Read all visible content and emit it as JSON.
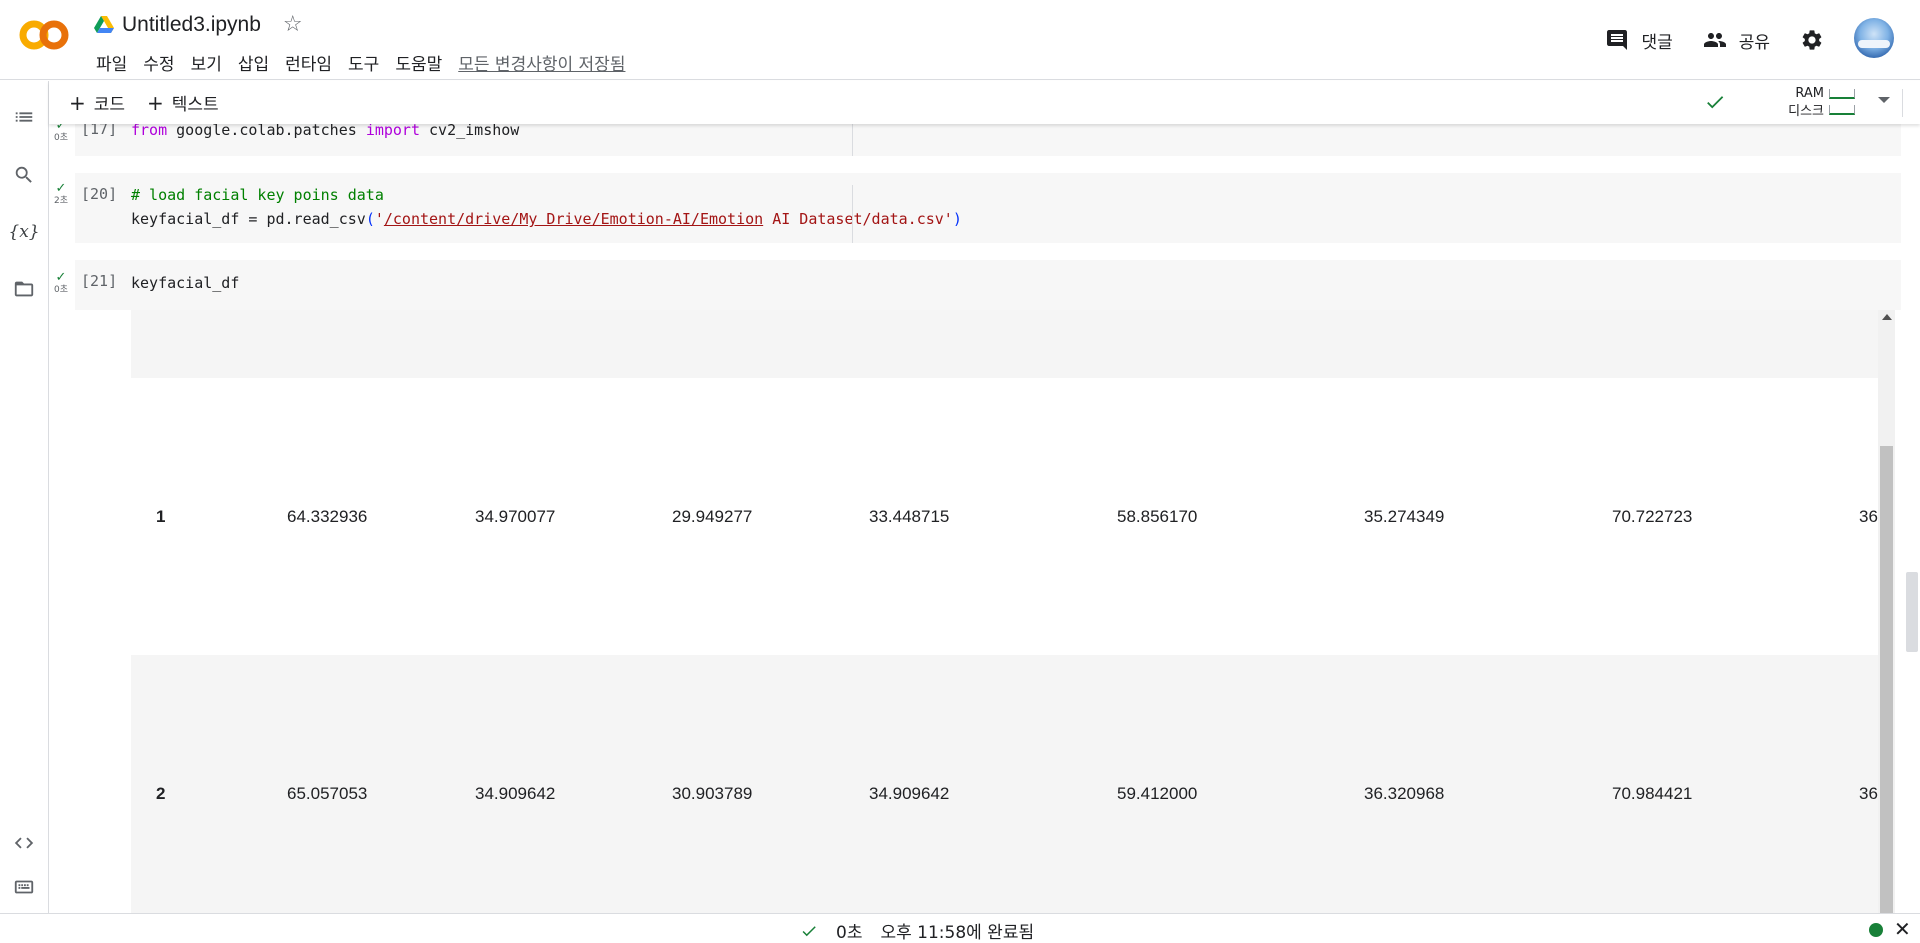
{
  "header": {
    "title": "Untitled3.ipynb",
    "menu": [
      "파일",
      "수정",
      "보기",
      "삽입",
      "런타임",
      "도구",
      "도움말"
    ],
    "saved_status": "모든 변경사항이 저장됨",
    "comment_label": "댓글",
    "share_label": "공유",
    "icons": {
      "logo": "colab-logo",
      "drive": "drive-icon",
      "star": "star-icon",
      "comment": "comment-icon",
      "share": "people-icon",
      "settings": "gear-icon"
    }
  },
  "toolbar": {
    "add_code": "코드",
    "add_text": "텍스트",
    "resources": {
      "ram": "RAM",
      "disk": "디스크"
    }
  },
  "cells": [
    {
      "exec_count": "[17]",
      "run_time": "0초",
      "code": {
        "kw1": "from",
        "mod": " google.colab.patches ",
        "kw2": "import",
        "name": " cv2_imshow"
      }
    },
    {
      "exec_count": "[20]",
      "run_time": "2초",
      "code": {
        "comment": "# load facial key poins data",
        "prefix": "keyfacial_df = pd.read_csv",
        "open": "(",
        "q1": "'",
        "path_link": "/content/drive/My Drive/Emotion-AI/Emotion",
        "path_rest": " AI Dataset/data.csv",
        "q2": "'",
        "close": ")"
      }
    },
    {
      "exec_count": "[21]",
      "run_time": "0초",
      "code": {
        "line": "keyfacial_df"
      }
    }
  ],
  "output_table": {
    "rows": [
      {
        "index": "1",
        "values": [
          "64.332936",
          "34.970077",
          "29.949277",
          "33.448715",
          "58.856170",
          "35.274349",
          "70.722723",
          "36"
        ]
      },
      {
        "index": "2",
        "values": [
          "65.057053",
          "34.909642",
          "30.903789",
          "34.909642",
          "59.412000",
          "36.320968",
          "70.984421",
          "36"
        ]
      }
    ]
  },
  "statusbar": {
    "elapsed": "0초",
    "completed": "오후 11:58에 완료됨"
  },
  "colors": {
    "accent_green": "#188038",
    "keyword": "#af00db",
    "comment": "#008000",
    "string": "#a31515",
    "cell_bg": "#f7f7f7"
  }
}
